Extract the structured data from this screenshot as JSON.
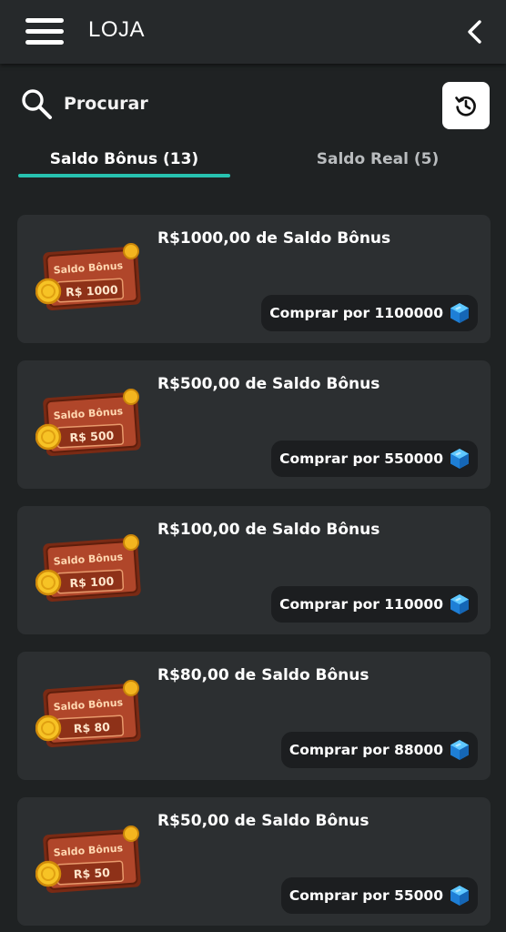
{
  "header": {
    "title": "LOJA",
    "menu_icon": "hamburger-menu-icon",
    "back_icon": "chevron-left-icon"
  },
  "search": {
    "label": "Procurar",
    "icon": "search-icon"
  },
  "history_button": {
    "icon": "history-icon"
  },
  "tabs": [
    {
      "label": "Saldo Bônus (13)",
      "active": true
    },
    {
      "label": "Saldo Real (5)",
      "active": false
    }
  ],
  "colors": {
    "accent": "#27c2b0",
    "card_bg": "#2c2f31",
    "page_bg": "#1f2223",
    "gem": "#2fa8f0"
  },
  "items": [
    {
      "title": "R$1000,00 de Saldo Bônus",
      "buy_label": "Comprar por 1100000",
      "badge_top": "Saldo Bônus",
      "badge_value": "R$ 1000"
    },
    {
      "title": "R$500,00 de Saldo Bônus",
      "buy_label": "Comprar por 550000",
      "badge_top": "Saldo Bônus",
      "badge_value": "R$ 500"
    },
    {
      "title": "R$100,00 de Saldo Bônus",
      "buy_label": "Comprar por 110000",
      "badge_top": "Saldo Bônus",
      "badge_value": "R$ 100"
    },
    {
      "title": "R$80,00 de Saldo Bônus",
      "buy_label": "Comprar por 88000",
      "badge_top": "Saldo Bônus",
      "badge_value": "R$ 80"
    },
    {
      "title": "R$50,00 de Saldo Bônus",
      "buy_label": "Comprar por 55000",
      "badge_top": "Saldo Bônus",
      "badge_value": "R$ 50"
    }
  ]
}
